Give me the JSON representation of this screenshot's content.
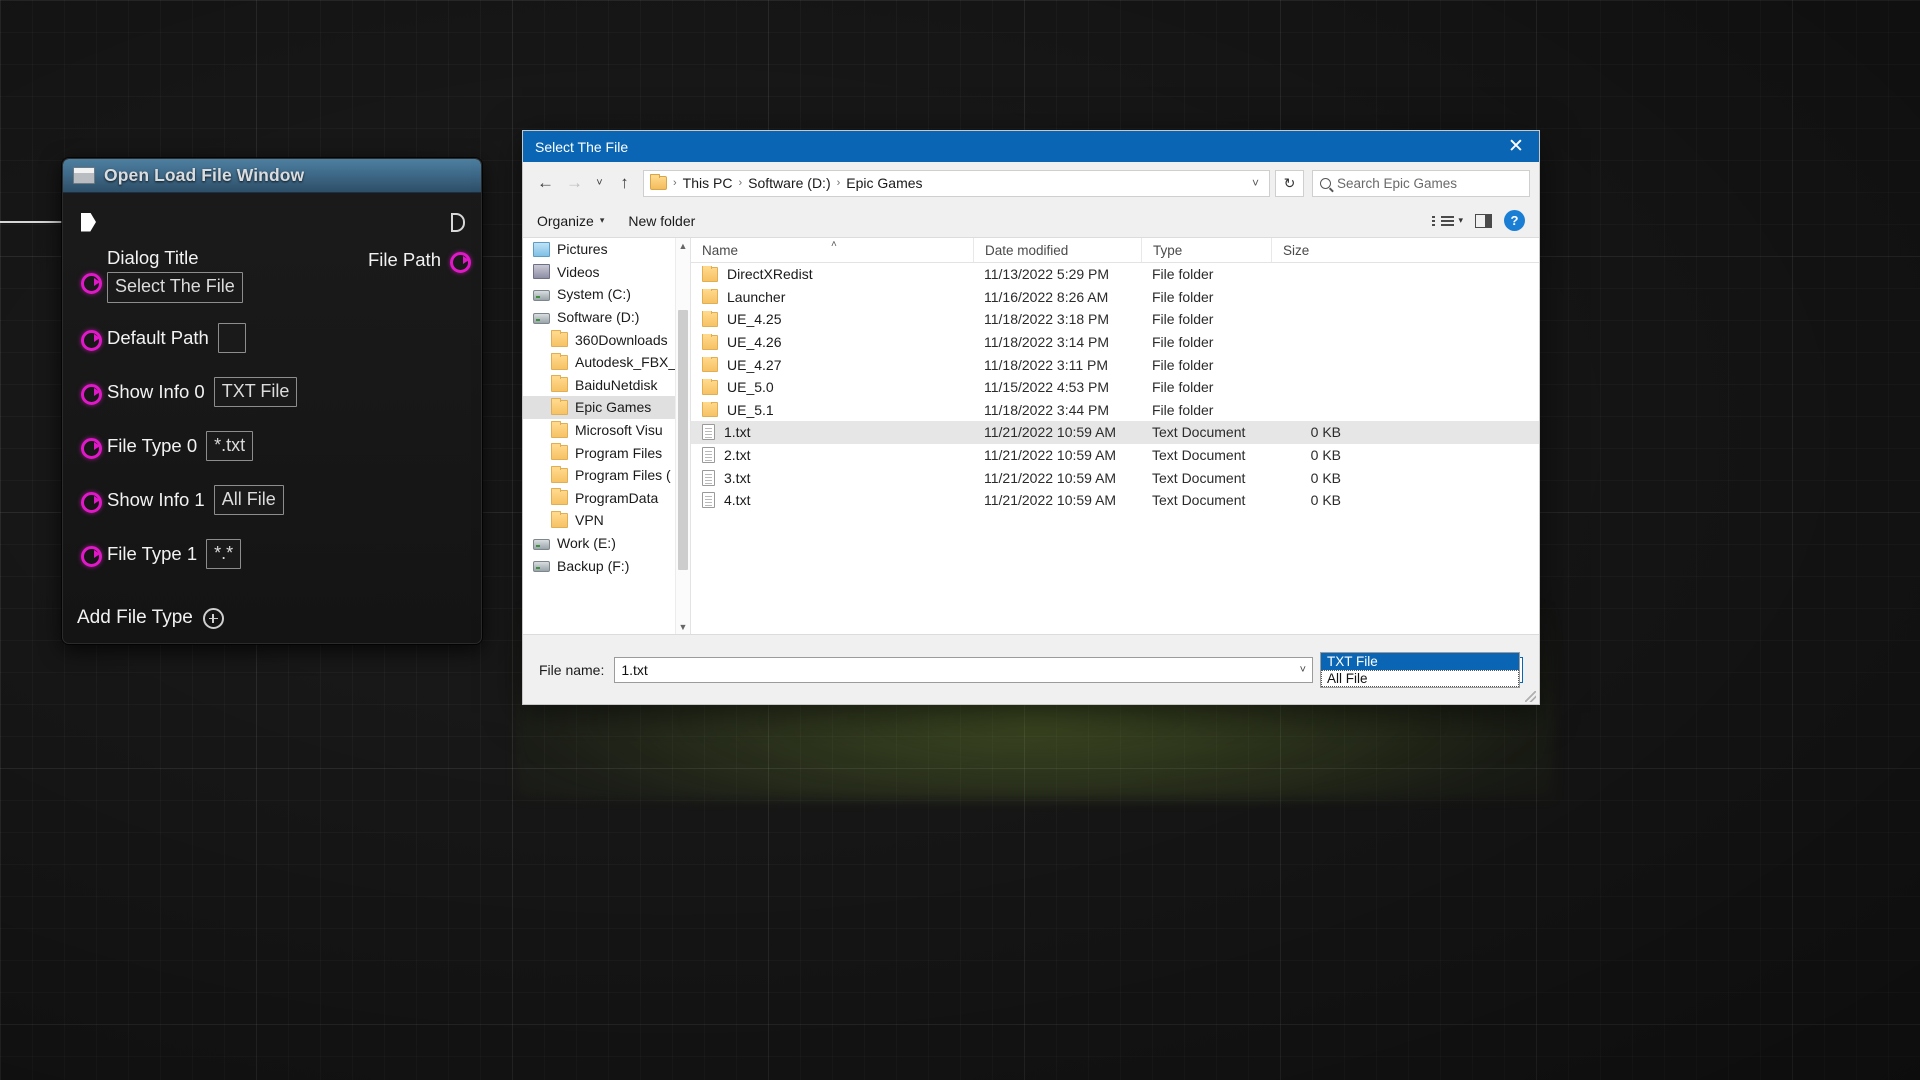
{
  "blueprint_node": {
    "title": "Open Load File Window",
    "exec_in_name": "exec-in-pin",
    "exec_out_name": "exec-out-pin",
    "output_pin_label": "File Path",
    "add_file_type_label": "Add File Type",
    "pin_color": "#e018c8",
    "title_color": "#3f6a89",
    "pins": [
      {
        "label": "Dialog Title",
        "value": "Select The File",
        "empty": false
      },
      {
        "label": "Default Path",
        "value": "",
        "empty": true
      },
      {
        "label": "Show Info 0",
        "value": "TXT File",
        "empty": false
      },
      {
        "label": "File Type 0",
        "value": "*.txt",
        "empty": false
      },
      {
        "label": "Show Info 1",
        "value": "All File",
        "empty": false
      },
      {
        "label": "File Type 1",
        "value": "*.*",
        "empty": false
      }
    ]
  },
  "file_dialog": {
    "title": "Select The File",
    "close_label": "✕",
    "nav": {
      "back": "←",
      "forward": "→",
      "recent": "˅",
      "up": "↑",
      "refresh": "↻",
      "dropdown_caret": "˅"
    },
    "breadcrumb": [
      "This PC",
      "Software (D:)",
      "Epic Games"
    ],
    "breadcrumb_separator": "›",
    "search": {
      "placeholder": "Search Epic Games",
      "icon": "search-icon"
    },
    "toolbar": {
      "organize": "Organize",
      "organize_caret": "▾",
      "new_folder": "New folder",
      "help": "?"
    },
    "sidebar": [
      {
        "label": "Pictures",
        "icon": "pictures-icon",
        "indent": false,
        "selected": false
      },
      {
        "label": "Videos",
        "icon": "videos-icon",
        "indent": false,
        "selected": false
      },
      {
        "label": "System (C:)",
        "icon": "drive-icon",
        "indent": false,
        "selected": false
      },
      {
        "label": "Software (D:)",
        "icon": "drive-icon",
        "indent": false,
        "selected": false
      },
      {
        "label": "360Downloads",
        "icon": "folder-icon",
        "indent": true,
        "selected": false
      },
      {
        "label": "Autodesk_FBX_",
        "icon": "folder-icon",
        "indent": true,
        "selected": false
      },
      {
        "label": "BaiduNetdisk",
        "icon": "folder-icon",
        "indent": true,
        "selected": false
      },
      {
        "label": "Epic Games",
        "icon": "folder-icon",
        "indent": true,
        "selected": true
      },
      {
        "label": "Microsoft Visu",
        "icon": "folder-icon",
        "indent": true,
        "selected": false
      },
      {
        "label": "Program Files",
        "icon": "folder-icon",
        "indent": true,
        "selected": false
      },
      {
        "label": "Program Files (",
        "icon": "folder-icon",
        "indent": true,
        "selected": false
      },
      {
        "label": "ProgramData",
        "icon": "folder-icon",
        "indent": true,
        "selected": false
      },
      {
        "label": "VPN",
        "icon": "folder-icon",
        "indent": true,
        "selected": false
      },
      {
        "label": "Work (E:)",
        "icon": "drive-icon",
        "indent": false,
        "selected": false
      },
      {
        "label": "Backup (F:)",
        "icon": "drive-icon",
        "indent": false,
        "selected": false
      }
    ],
    "columns": [
      "Name",
      "Date modified",
      "Type",
      "Size"
    ],
    "sort_indicator": "˄",
    "rows": [
      {
        "name": "DirectXRedist",
        "date": "11/13/2022 5:29 PM",
        "type": "File folder",
        "size": "",
        "icon": "folder-icon",
        "selected": false
      },
      {
        "name": "Launcher",
        "date": "11/16/2022 8:26 AM",
        "type": "File folder",
        "size": "",
        "icon": "folder-icon",
        "selected": false
      },
      {
        "name": "UE_4.25",
        "date": "11/18/2022 3:18 PM",
        "type": "File folder",
        "size": "",
        "icon": "folder-icon",
        "selected": false
      },
      {
        "name": "UE_4.26",
        "date": "11/18/2022 3:14 PM",
        "type": "File folder",
        "size": "",
        "icon": "folder-icon",
        "selected": false
      },
      {
        "name": "UE_4.27",
        "date": "11/18/2022 3:11 PM",
        "type": "File folder",
        "size": "",
        "icon": "folder-icon",
        "selected": false
      },
      {
        "name": "UE_5.0",
        "date": "11/15/2022 4:53 PM",
        "type": "File folder",
        "size": "",
        "icon": "folder-icon",
        "selected": false
      },
      {
        "name": "UE_5.1",
        "date": "11/18/2022 3:44 PM",
        "type": "File folder",
        "size": "",
        "icon": "folder-icon",
        "selected": false
      },
      {
        "name": "1.txt",
        "date": "11/21/2022 10:59 AM",
        "type": "Text Document",
        "size": "0 KB",
        "icon": "text-file-icon",
        "selected": true
      },
      {
        "name": "2.txt",
        "date": "11/21/2022 10:59 AM",
        "type": "Text Document",
        "size": "0 KB",
        "icon": "text-file-icon",
        "selected": false
      },
      {
        "name": "3.txt",
        "date": "11/21/2022 10:59 AM",
        "type": "Text Document",
        "size": "0 KB",
        "icon": "text-file-icon",
        "selected": false
      },
      {
        "name": "4.txt",
        "date": "11/21/2022 10:59 AM",
        "type": "Text Document",
        "size": "0 KB",
        "icon": "text-file-icon",
        "selected": false
      }
    ],
    "bottom": {
      "filename_label": "File name:",
      "filename_value": "1.txt",
      "filetype_value": "TXT File",
      "caret": "˅",
      "options": [
        {
          "label": "TXT File",
          "highlighted": true
        },
        {
          "label": "All File",
          "highlighted": false
        }
      ]
    }
  }
}
